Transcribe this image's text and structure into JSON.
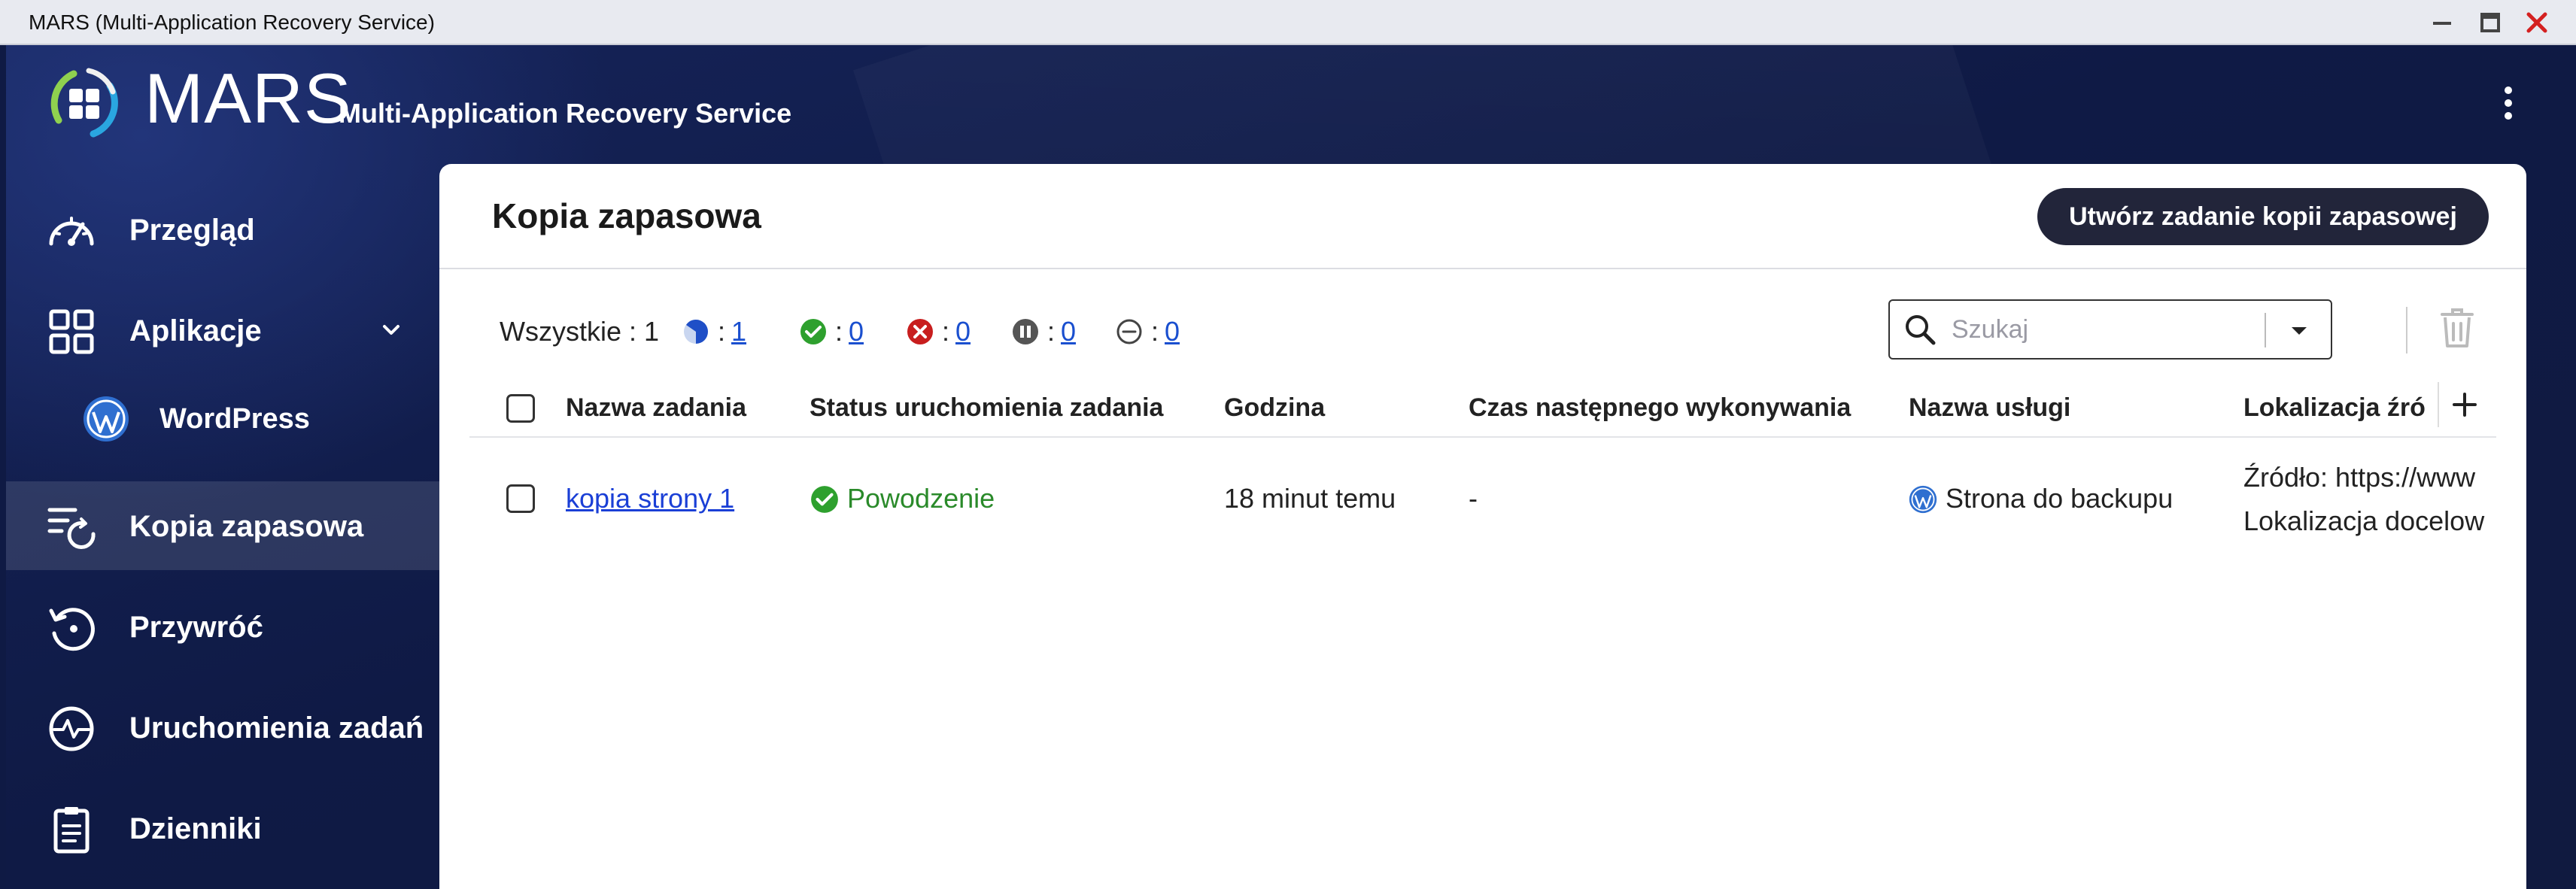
{
  "window": {
    "title": "MARS (Multi-Application Recovery Service)"
  },
  "header": {
    "brand": "MARS",
    "subtitle": "Multi-Application Recovery Service"
  },
  "sidebar": {
    "items": [
      {
        "label": "Przegląd"
      },
      {
        "label": "Aplikacje"
      },
      {
        "label": "Kopia zapasowa"
      },
      {
        "label": "Przywróć"
      },
      {
        "label": "Uruchomienia zadań"
      },
      {
        "label": "Dzienniki"
      }
    ],
    "sub_items": [
      {
        "label": "WordPress"
      }
    ]
  },
  "panel": {
    "title": "Kopia zapasowa",
    "create_button": "Utwórz zadanie kopii zapasowej",
    "filters": {
      "all_label": "Wszystkie : 1",
      "colon": ":",
      "in_progress": "1",
      "success": "0",
      "failed": "0",
      "paused": "0",
      "disabled": "0"
    },
    "search": {
      "placeholder": "Szukaj",
      "value": ""
    },
    "table": {
      "headers": [
        "Nazwa zadania",
        "Status uruchomienia zadania",
        "Godzina",
        "Czas następnego wykonywania",
        "Nazwa usługi",
        "Lokalizacja źró"
      ],
      "rows": [
        {
          "name": "kopia strony 1",
          "status": "Powodzenie",
          "time": "18 minut temu",
          "next_run": "-",
          "service": "Strona do backupu",
          "location_line1": "Źródło: https://www",
          "location_line2": "Lokalizacja docelow"
        }
      ]
    }
  },
  "colors": {
    "accent_dark": "#22253a",
    "success": "#2ea02e",
    "failed": "#c81e1e",
    "link": "#1a3fd6",
    "sidebar_bg": "#0f1a44"
  }
}
